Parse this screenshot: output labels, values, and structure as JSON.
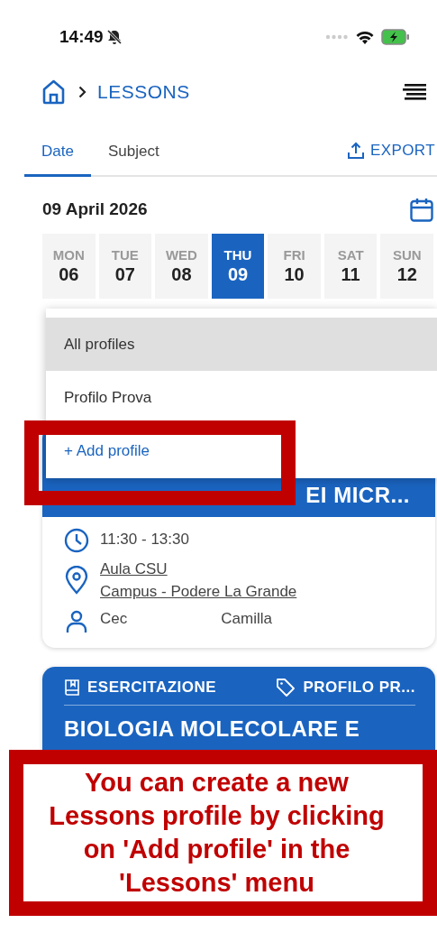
{
  "status_bar": {
    "time": "14:49"
  },
  "header": {
    "breadcrumb": "LESSONS"
  },
  "tabs": [
    {
      "label": "Date",
      "selected": true
    },
    {
      "label": "Subject",
      "selected": false
    }
  ],
  "export_button": {
    "label": "EXPORT"
  },
  "date_title": "09 April 2026",
  "days": [
    {
      "weekday": "MON",
      "day": "06",
      "selected": false
    },
    {
      "weekday": "TUE",
      "day": "07",
      "selected": false
    },
    {
      "weekday": "WED",
      "day": "08",
      "selected": false
    },
    {
      "weekday": "THU",
      "day": "09",
      "selected": true
    },
    {
      "weekday": "FRI",
      "day": "10",
      "selected": false
    },
    {
      "weekday": "SAT",
      "day": "11",
      "selected": false
    },
    {
      "weekday": "SUN",
      "day": "12",
      "selected": false
    }
  ],
  "profile_menu": {
    "options": [
      {
        "label": "All profiles",
        "selected": true
      },
      {
        "label": "Profilo Prova",
        "selected": false
      }
    ],
    "add_label": "+ Add profile"
  },
  "lesson_cards": [
    {
      "kind": "detail",
      "title": "EI MICR...",
      "time": "11:30 - 13:30",
      "room": "Aula CSU",
      "location": "Campus - Podere La Grande",
      "teacher_parts": [
        "Cec",
        "Camilla"
      ]
    },
    {
      "kind": "summary",
      "type": "ESERCITAZIONE",
      "profile": "PROFILO PR...",
      "title": "BIOLOGIA MOLECOLARE E"
    }
  ],
  "callout": {
    "text": "You can create a new Lessons profile by clicking on 'Add profile' in the 'Lessons' menu"
  }
}
